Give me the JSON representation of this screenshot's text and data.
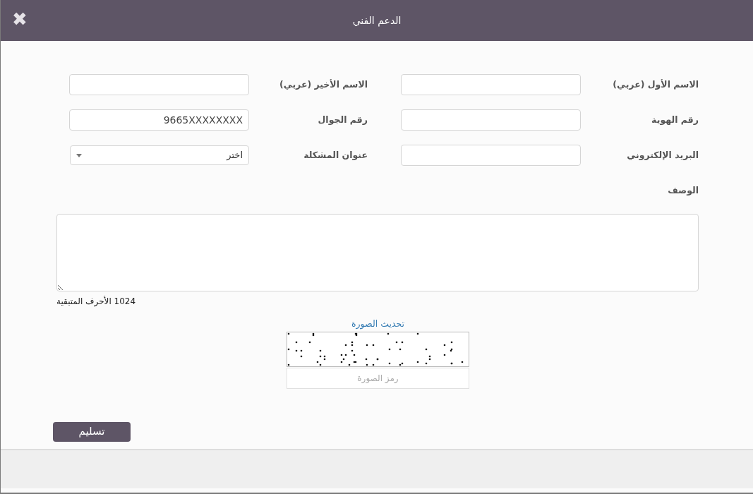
{
  "dialog": {
    "title": "الدعم الفني",
    "close_icon": "✖"
  },
  "fields": [
    {
      "label": "الاسم الأول (عربي)",
      "kind": "text"
    },
    {
      "label": "الاسم الأخير (عربي)",
      "kind": "text"
    },
    {
      "label": "رقم الهوية",
      "kind": "text"
    },
    {
      "label": "رقم الجوال",
      "kind": "text",
      "value": "9665XXXXXXXX"
    },
    {
      "label": "البريد الإلكتروني",
      "kind": "text"
    },
    {
      "label": "عنوان المشكلة",
      "kind": "select",
      "value": "اختر"
    }
  ],
  "description": {
    "label": "الوصف",
    "counter": "1024 الأحرف المتبقية"
  },
  "captcha": {
    "refresh_link": "تحديث الصورة",
    "placeholder": "رمز الصورة"
  },
  "submit_button": "تسليم"
}
